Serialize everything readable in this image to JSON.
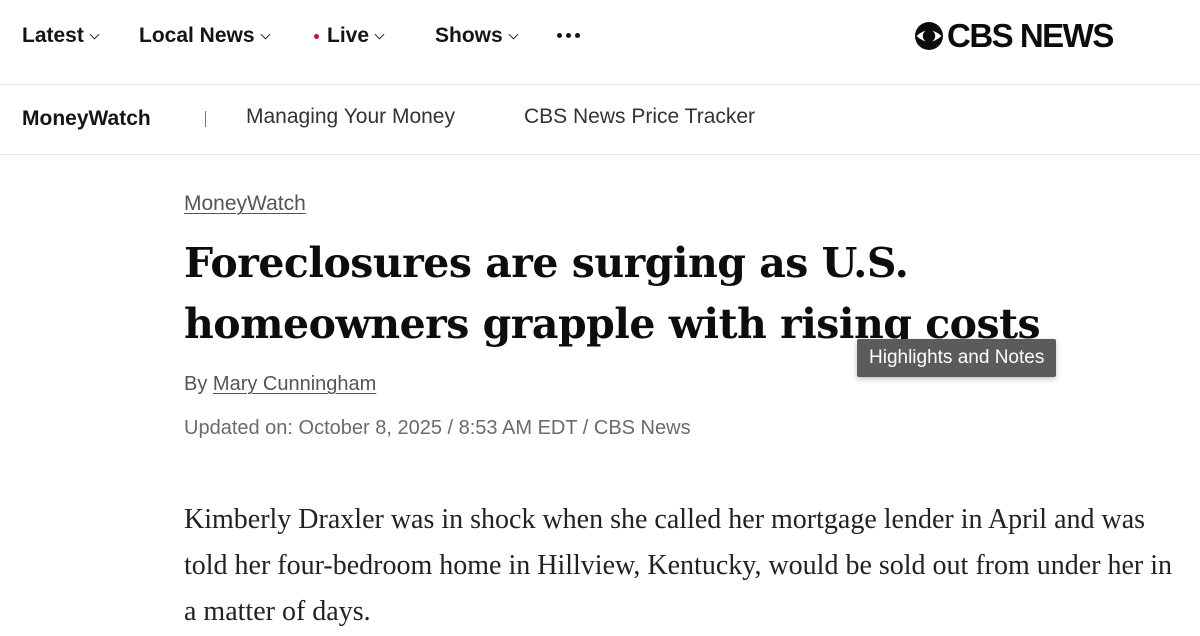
{
  "top_nav": {
    "items": [
      {
        "label": "Latest"
      },
      {
        "label": "Local News"
      },
      {
        "label": "Live"
      },
      {
        "label": "Shows"
      }
    ],
    "more_icon": "more-dots-icon",
    "logo_text": "CBS NEWS",
    "logo_icon": "cbs-eye-icon"
  },
  "sub_nav": {
    "brand": "MoneyWatch",
    "links": [
      {
        "label": "Managing Your Money"
      },
      {
        "label": "CBS News Price Tracker"
      }
    ]
  },
  "article": {
    "kicker": "MoneyWatch",
    "headline": "Foreclosures are surging as U.S. homeowners grapple with rising costs",
    "byline_prefix": "By",
    "author": "Mary Cunningham",
    "dateline": "Updated on: October 8, 2025 / 8:53 AM EDT / CBS News",
    "body": "Kimberly Draxler was in shock when she called her mortgage lender in April and was told her four-bedroom home in Hillview, Kentucky, would be sold out from under her in a matter of days."
  },
  "tooltip": {
    "text": "Highlights and Notes"
  },
  "colors": {
    "live_dot": "#c8102e",
    "tooltip_bg": "#5b5b5b"
  }
}
